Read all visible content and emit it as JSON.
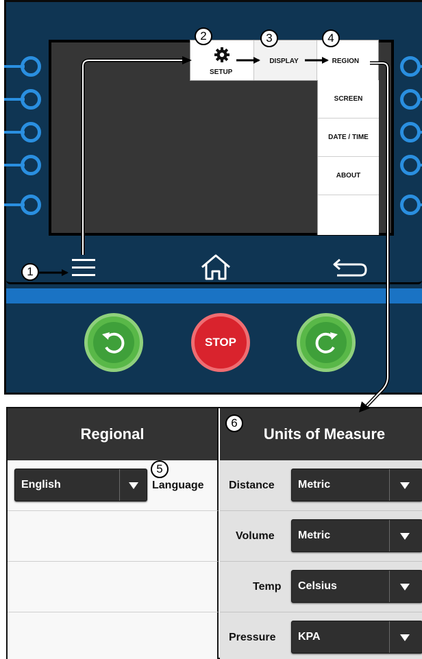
{
  "controller": {
    "setup_menu": {
      "setup_label": "SETUP",
      "display_label": "DISPLAY",
      "region_label": "REGION"
    },
    "region_submenu": [
      "SCREEN",
      "DATE / TIME",
      "ABOUT"
    ],
    "stop_label": "STOP",
    "icons": {
      "menu": "hamburger-icon",
      "home": "home-icon",
      "back": "return-arrow-icon",
      "setup": "gear-icon",
      "reverse": "counterclockwise-arrow-icon",
      "forward": "clockwise-arrow-icon"
    }
  },
  "callouts": [
    "1",
    "2",
    "3",
    "4",
    "5",
    "6"
  ],
  "regional_table": {
    "regional_header": "Regional",
    "units_header": "Units of Measure",
    "language": {
      "label": "Language",
      "value": "English"
    },
    "units": [
      {
        "label": "Distance",
        "value": "Metric"
      },
      {
        "label": "Volume",
        "value": "Metric"
      },
      {
        "label": "Temp",
        "value": "Celsius"
      },
      {
        "label": "Pressure",
        "value": "KPA"
      }
    ]
  },
  "colors": {
    "panel": "#0f3553",
    "accent_blue": "#1a73c4",
    "stop_red": "#d9232d",
    "go_green": "#59b848",
    "header_dark": "#333333",
    "dropdown": "#2f2f2f"
  }
}
